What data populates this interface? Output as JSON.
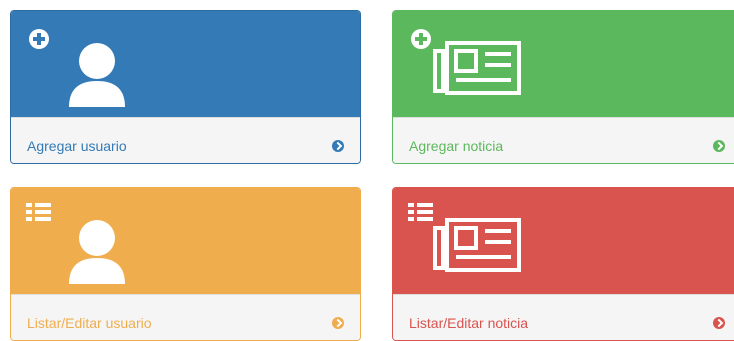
{
  "cards": [
    {
      "label": "Agregar usuario",
      "color": "#337ab7",
      "icon": "add-user-icon",
      "badge": "plus-circle-icon",
      "arrow": "arrow-circle-right-icon"
    },
    {
      "label": "Agregar noticia",
      "color": "#5cb85c",
      "icon": "newspaper-icon",
      "badge": "plus-circle-icon",
      "arrow": "arrow-circle-right-icon"
    },
    {
      "label": "Listar/Editar usuario",
      "color": "#f0ad4e",
      "icon": "user-icon",
      "badge": "list-icon",
      "arrow": "arrow-circle-right-icon"
    },
    {
      "label": "Listar/Editar noticia",
      "color": "#d9534f",
      "icon": "newspaper-icon",
      "badge": "list-icon",
      "arrow": "arrow-circle-right-icon"
    }
  ]
}
